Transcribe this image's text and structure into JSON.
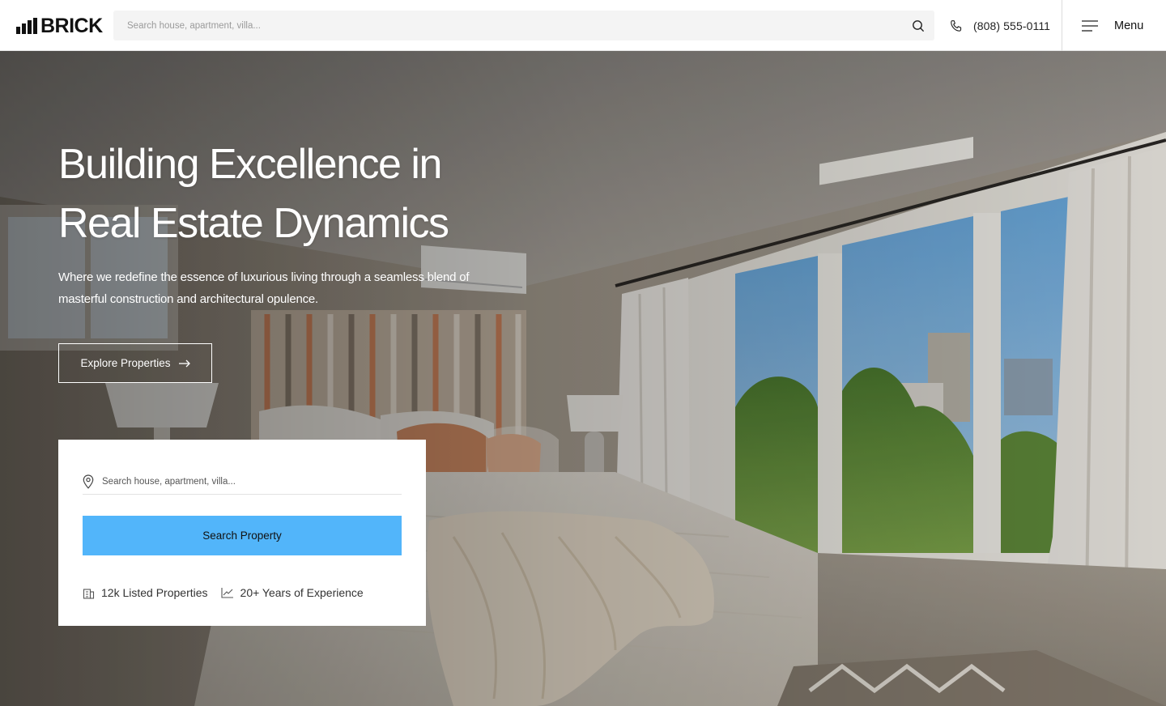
{
  "header": {
    "logo_text": "BRICK",
    "search_placeholder": "Search house, apartment, villa...",
    "phone": "(808) 555-0111",
    "menu_label": "Menu"
  },
  "hero": {
    "title_line_1": "Building Excellence in",
    "title_line_2": "Real Estate Dynamics",
    "subtitle": "Where we redefine the essence of luxurious living through a seamless blend of masterful construction and architectural opulence.",
    "explore_label": "Explore Properties"
  },
  "search_card": {
    "input_placeholder": "Search house, apartment, villa...",
    "button_label": "Search Property",
    "stats": [
      {
        "icon": "building-icon",
        "label": "12k Listed Properties"
      },
      {
        "icon": "chart-line-icon",
        "label": "20+ Years of Experience"
      }
    ]
  },
  "colors": {
    "accent": "#52b5fa",
    "text_dark": "#111111",
    "header_bg": "#ffffff",
    "search_bg": "#f4f4f4"
  }
}
